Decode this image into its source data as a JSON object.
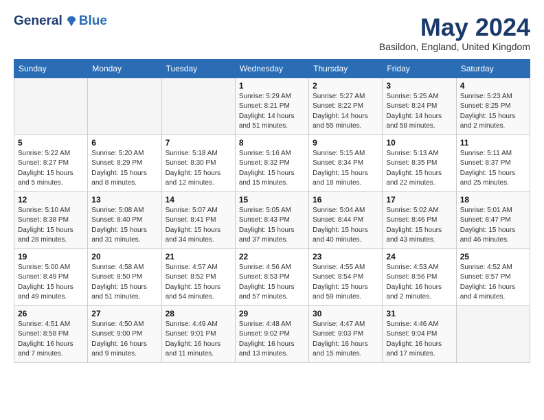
{
  "header": {
    "logo": {
      "general": "General",
      "blue": "Blue",
      "bird_icon": "▲"
    },
    "title": "May 2024",
    "subtitle": "Basildon, England, United Kingdom"
  },
  "columns": [
    "Sunday",
    "Monday",
    "Tuesday",
    "Wednesday",
    "Thursday",
    "Friday",
    "Saturday"
  ],
  "weeks": [
    [
      {
        "day": "",
        "info": ""
      },
      {
        "day": "",
        "info": ""
      },
      {
        "day": "",
        "info": ""
      },
      {
        "day": "1",
        "info": "Sunrise: 5:29 AM\nSunset: 8:21 PM\nDaylight: 14 hours\nand 51 minutes."
      },
      {
        "day": "2",
        "info": "Sunrise: 5:27 AM\nSunset: 8:22 PM\nDaylight: 14 hours\nand 55 minutes."
      },
      {
        "day": "3",
        "info": "Sunrise: 5:25 AM\nSunset: 8:24 PM\nDaylight: 14 hours\nand 58 minutes."
      },
      {
        "day": "4",
        "info": "Sunrise: 5:23 AM\nSunset: 8:25 PM\nDaylight: 15 hours\nand 2 minutes."
      }
    ],
    [
      {
        "day": "5",
        "info": "Sunrise: 5:22 AM\nSunset: 8:27 PM\nDaylight: 15 hours\nand 5 minutes."
      },
      {
        "day": "6",
        "info": "Sunrise: 5:20 AM\nSunset: 8:29 PM\nDaylight: 15 hours\nand 8 minutes."
      },
      {
        "day": "7",
        "info": "Sunrise: 5:18 AM\nSunset: 8:30 PM\nDaylight: 15 hours\nand 12 minutes."
      },
      {
        "day": "8",
        "info": "Sunrise: 5:16 AM\nSunset: 8:32 PM\nDaylight: 15 hours\nand 15 minutes."
      },
      {
        "day": "9",
        "info": "Sunrise: 5:15 AM\nSunset: 8:34 PM\nDaylight: 15 hours\nand 18 minutes."
      },
      {
        "day": "10",
        "info": "Sunrise: 5:13 AM\nSunset: 8:35 PM\nDaylight: 15 hours\nand 22 minutes."
      },
      {
        "day": "11",
        "info": "Sunrise: 5:11 AM\nSunset: 8:37 PM\nDaylight: 15 hours\nand 25 minutes."
      }
    ],
    [
      {
        "day": "12",
        "info": "Sunrise: 5:10 AM\nSunset: 8:38 PM\nDaylight: 15 hours\nand 28 minutes."
      },
      {
        "day": "13",
        "info": "Sunrise: 5:08 AM\nSunset: 8:40 PM\nDaylight: 15 hours\nand 31 minutes."
      },
      {
        "day": "14",
        "info": "Sunrise: 5:07 AM\nSunset: 8:41 PM\nDaylight: 15 hours\nand 34 minutes."
      },
      {
        "day": "15",
        "info": "Sunrise: 5:05 AM\nSunset: 8:43 PM\nDaylight: 15 hours\nand 37 minutes."
      },
      {
        "day": "16",
        "info": "Sunrise: 5:04 AM\nSunset: 8:44 PM\nDaylight: 15 hours\nand 40 minutes."
      },
      {
        "day": "17",
        "info": "Sunrise: 5:02 AM\nSunset: 8:46 PM\nDaylight: 15 hours\nand 43 minutes."
      },
      {
        "day": "18",
        "info": "Sunrise: 5:01 AM\nSunset: 8:47 PM\nDaylight: 15 hours\nand 46 minutes."
      }
    ],
    [
      {
        "day": "19",
        "info": "Sunrise: 5:00 AM\nSunset: 8:49 PM\nDaylight: 15 hours\nand 49 minutes."
      },
      {
        "day": "20",
        "info": "Sunrise: 4:58 AM\nSunset: 8:50 PM\nDaylight: 15 hours\nand 51 minutes."
      },
      {
        "day": "21",
        "info": "Sunrise: 4:57 AM\nSunset: 8:52 PM\nDaylight: 15 hours\nand 54 minutes."
      },
      {
        "day": "22",
        "info": "Sunrise: 4:56 AM\nSunset: 8:53 PM\nDaylight: 15 hours\nand 57 minutes."
      },
      {
        "day": "23",
        "info": "Sunrise: 4:55 AM\nSunset: 8:54 PM\nDaylight: 15 hours\nand 59 minutes."
      },
      {
        "day": "24",
        "info": "Sunrise: 4:53 AM\nSunset: 8:56 PM\nDaylight: 16 hours\nand 2 minutes."
      },
      {
        "day": "25",
        "info": "Sunrise: 4:52 AM\nSunset: 8:57 PM\nDaylight: 16 hours\nand 4 minutes."
      }
    ],
    [
      {
        "day": "26",
        "info": "Sunrise: 4:51 AM\nSunset: 8:58 PM\nDaylight: 16 hours\nand 7 minutes."
      },
      {
        "day": "27",
        "info": "Sunrise: 4:50 AM\nSunset: 9:00 PM\nDaylight: 16 hours\nand 9 minutes."
      },
      {
        "day": "28",
        "info": "Sunrise: 4:49 AM\nSunset: 9:01 PM\nDaylight: 16 hours\nand 11 minutes."
      },
      {
        "day": "29",
        "info": "Sunrise: 4:48 AM\nSunset: 9:02 PM\nDaylight: 16 hours\nand 13 minutes."
      },
      {
        "day": "30",
        "info": "Sunrise: 4:47 AM\nSunset: 9:03 PM\nDaylight: 16 hours\nand 15 minutes."
      },
      {
        "day": "31",
        "info": "Sunrise: 4:46 AM\nSunset: 9:04 PM\nDaylight: 16 hours\nand 17 minutes."
      },
      {
        "day": "",
        "info": ""
      }
    ]
  ]
}
